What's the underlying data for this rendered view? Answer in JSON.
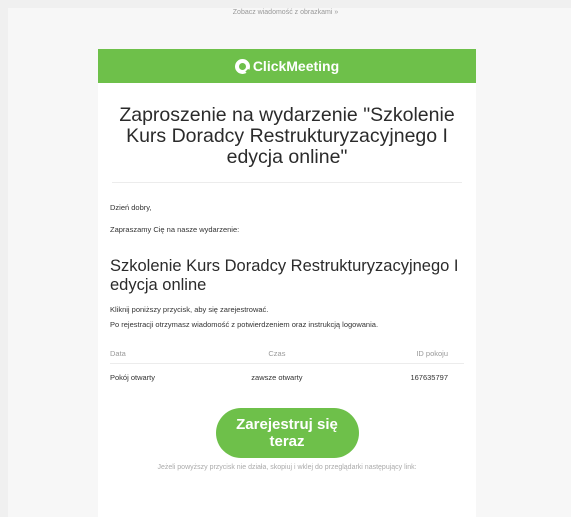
{
  "top_link": "Zobacz wiadomość z obrazkami »",
  "brand": {
    "name": "ClickMeeting",
    "color": "#6ec04a"
  },
  "title": "Zaproszenie na wydarzenie \"Szkolenie Kurs Doradcy Restrukturyzacyjnego I edycja online\"",
  "greeting": "Dzień dobry,",
  "invite": "Zapraszamy Cię na nasze wydarzenie:",
  "event_title": "Szkolenie Kurs Doradcy Restrukturyzacyjnego I edycja online",
  "instruction1": "Kliknij poniższy przycisk, aby się zarejestrować.",
  "instruction2": "Po rejestracji otrzymasz wiadomość z potwierdzeniem oraz instrukcją logowania.",
  "table": {
    "headers": [
      "Data",
      "Czas",
      "ID pokoju"
    ],
    "row": [
      "Pokój otwarty",
      "zawsze otwarty",
      "167635797"
    ]
  },
  "cta_label": "Zarejestruj się teraz",
  "footer_note": "Jeżeli powyższy przycisk nie działa, skopiuj i wklej do przeglądarki następujący link:"
}
